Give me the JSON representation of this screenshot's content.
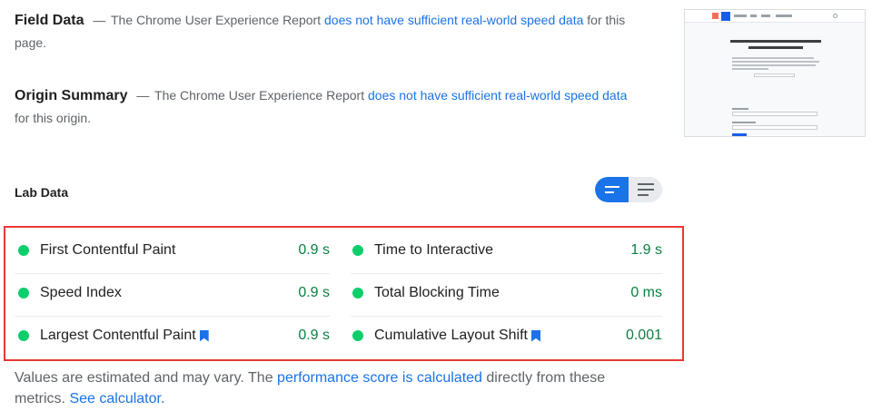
{
  "field_data": {
    "title": "Field Data",
    "dash": "—",
    "text_before": "The Chrome User Experience Report",
    "link": "does not have sufficient real-world speed data",
    "text_after": "for this page."
  },
  "origin_summary": {
    "title": "Origin Summary",
    "dash": "—",
    "text_before": "The Chrome User Experience Report",
    "link": "does not have sufficient real-world speed data",
    "text_after": "for this origin."
  },
  "thumbnail": {
    "icon": "page-screenshot-thumbnail",
    "heading": "We are Sharing Marketing Growth Strategies to My Subscribers"
  },
  "lab_data": {
    "title": "Lab Data",
    "toggle": {
      "active": "summary-view",
      "inactive": "list-view"
    }
  },
  "metrics": [
    {
      "label": "First Contentful Paint",
      "value": "0.9 s",
      "status": "pass",
      "status_color": "#0cce6b",
      "bookmark": false
    },
    {
      "label": "Time to Interactive",
      "value": "1.9 s",
      "status": "pass",
      "status_color": "#0cce6b",
      "bookmark": false
    },
    {
      "label": "Speed Index",
      "value": "0.9 s",
      "status": "pass",
      "status_color": "#0cce6b",
      "bookmark": false
    },
    {
      "label": "Total Blocking Time",
      "value": "0 ms",
      "status": "pass",
      "status_color": "#0cce6b",
      "bookmark": false
    },
    {
      "label": "Largest Contentful Paint",
      "value": "0.9 s",
      "status": "pass",
      "status_color": "#0cce6b",
      "bookmark": true
    },
    {
      "label": "Cumulative Layout Shift",
      "value": "0.001",
      "status": "pass",
      "status_color": "#0cce6b",
      "bookmark": true
    }
  ],
  "footer": {
    "text1": "Values are estimated and may vary. The",
    "link1": "performance score is calculated",
    "text2": "directly from these metrics.",
    "link2": "See calculator."
  },
  "colors": {
    "accent": "#1a73e8",
    "pass_value": "#0d8043",
    "highlight_border": "#e53935"
  }
}
